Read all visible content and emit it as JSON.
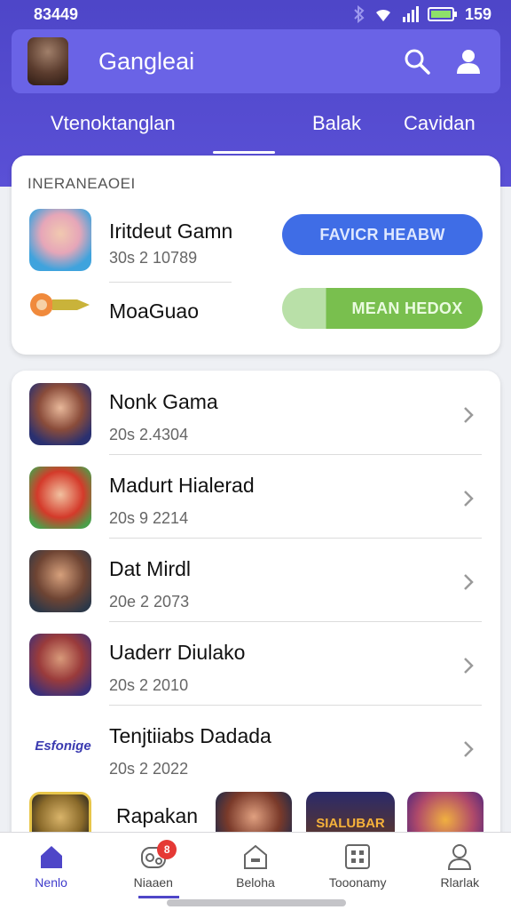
{
  "status_bar": {
    "time": "83449",
    "clock": "159"
  },
  "app_bar": {
    "title": "Gangleai",
    "logo": "pirate-character-logo",
    "icons": [
      "search-icon",
      "profile-icon"
    ]
  },
  "tabs": [
    {
      "label": "Vtenoktanglan",
      "active": true
    },
    {
      "label": "Balak",
      "active": false
    },
    {
      "label": "Cavidan",
      "active": false
    }
  ],
  "featured": {
    "section_label": "INERANEAOEI",
    "items": [
      {
        "name": "Iritdeut Gamn",
        "meta": "30s  2 10789",
        "button": "FAVICR HEABW",
        "button_color": "#3f6de6"
      },
      {
        "name": "MoaGuao",
        "meta": "",
        "button": "MEAN HEDOX",
        "button_color": "#79bf4e"
      }
    ]
  },
  "list": [
    {
      "name": "Nonk Gama",
      "meta": "20s  2.4304"
    },
    {
      "name": "Madurt Hialerad",
      "meta": "20s  9 2214"
    },
    {
      "name": "Dat Mirdl",
      "meta": "20e  2 2073"
    },
    {
      "name": "Uaderr Diulako",
      "meta": "20s  2 2010"
    },
    {
      "name": "Tenjtiiabs Dadada",
      "meta": "20s  2 2022"
    }
  ],
  "last_row": {
    "name": "Rapakan",
    "logo_text": "Esfonige",
    "tile_text": "SIALUBAR"
  },
  "bottom_nav": [
    {
      "label": "Nenlo",
      "icon": "home-icon",
      "active": true
    },
    {
      "label": "Niaaen",
      "icon": "games-icon",
      "active": false,
      "badge": "8"
    },
    {
      "label": "Beloha",
      "icon": "store-icon",
      "active": false
    },
    {
      "label": "Tooonamy",
      "icon": "grid-icon",
      "active": false
    },
    {
      "label": "Rlarlak",
      "icon": "person-icon",
      "active": false
    }
  ],
  "colors": {
    "accent": "#4e46c8",
    "blue_button": "#3f6de6",
    "green_button": "#79bf4e",
    "badge": "#e53935"
  }
}
